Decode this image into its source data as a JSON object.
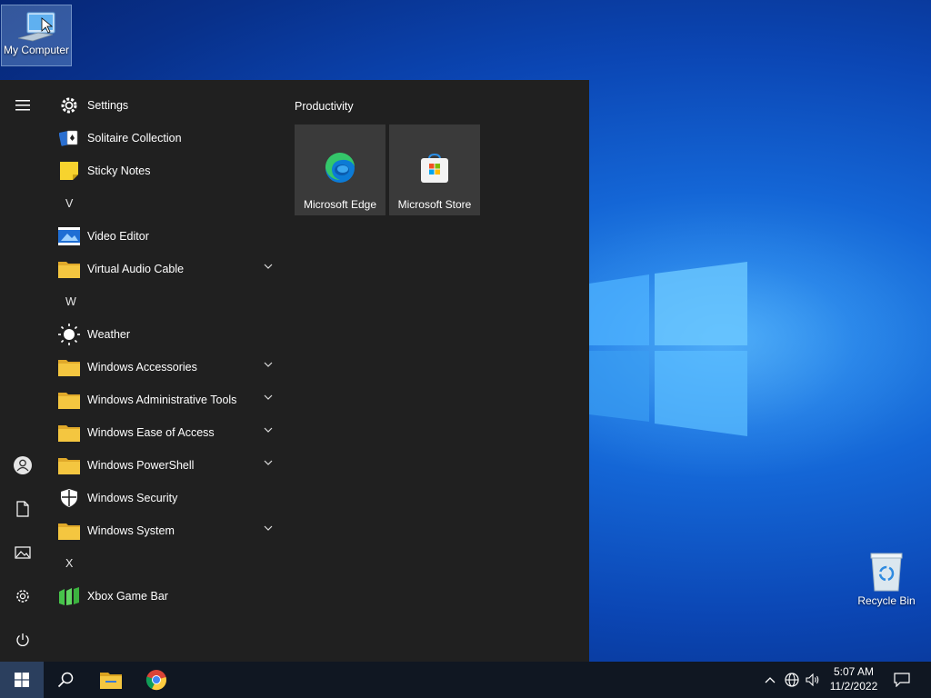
{
  "desktop": {
    "icons": [
      {
        "label": "My Computer"
      },
      {
        "label": "Recycle Bin"
      }
    ]
  },
  "start_menu": {
    "rail": {
      "icons": [
        "hamburger-icon",
        "user-icon",
        "document-icon",
        "pictures-icon",
        "settings-icon",
        "power-icon"
      ]
    },
    "apps": [
      {
        "type": "app",
        "label": "Settings",
        "icon": "gear-icon"
      },
      {
        "type": "app",
        "label": "Solitaire Collection",
        "icon": "solitaire-icon"
      },
      {
        "type": "app",
        "label": "Sticky Notes",
        "icon": "sticky-notes-icon"
      },
      {
        "type": "letter",
        "label": "V"
      },
      {
        "type": "app",
        "label": "Video Editor",
        "icon": "video-editor-icon"
      },
      {
        "type": "folder",
        "label": "Virtual Audio Cable",
        "icon": "folder-icon"
      },
      {
        "type": "letter",
        "label": "W"
      },
      {
        "type": "app",
        "label": "Weather",
        "icon": "weather-icon"
      },
      {
        "type": "folder",
        "label": "Windows Accessories",
        "icon": "folder-icon"
      },
      {
        "type": "folder",
        "label": "Windows Administrative Tools",
        "icon": "folder-icon"
      },
      {
        "type": "folder",
        "label": "Windows Ease of Access",
        "icon": "folder-icon"
      },
      {
        "type": "folder",
        "label": "Windows PowerShell",
        "icon": "folder-icon"
      },
      {
        "type": "app",
        "label": "Windows Security",
        "icon": "shield-icon"
      },
      {
        "type": "folder",
        "label": "Windows System",
        "icon": "folder-icon"
      },
      {
        "type": "letter",
        "label": "X"
      },
      {
        "type": "app",
        "label": "Xbox Game Bar",
        "icon": "xbox-game-bar-icon"
      }
    ],
    "tile_group": {
      "title": "Productivity",
      "tiles": [
        {
          "label": "Microsoft Edge",
          "icon": "edge-icon"
        },
        {
          "label": "Microsoft Store",
          "icon": "store-icon"
        }
      ]
    }
  },
  "taskbar": {
    "buttons": [
      "start-icon",
      "search-icon",
      "file-explorer-icon",
      "chrome-icon"
    ],
    "tray_icons": [
      "chevron-up-icon",
      "network-icon",
      "volume-icon",
      "notifications-icon"
    ],
    "clock": {
      "time": "5:07 AM",
      "date": "11/2/2022"
    }
  },
  "colors": {
    "start_bg": "#202020",
    "tile_bg": "#3a3a3a",
    "taskbar_bg": "#101722",
    "folder_yellow": "#f4c640"
  }
}
